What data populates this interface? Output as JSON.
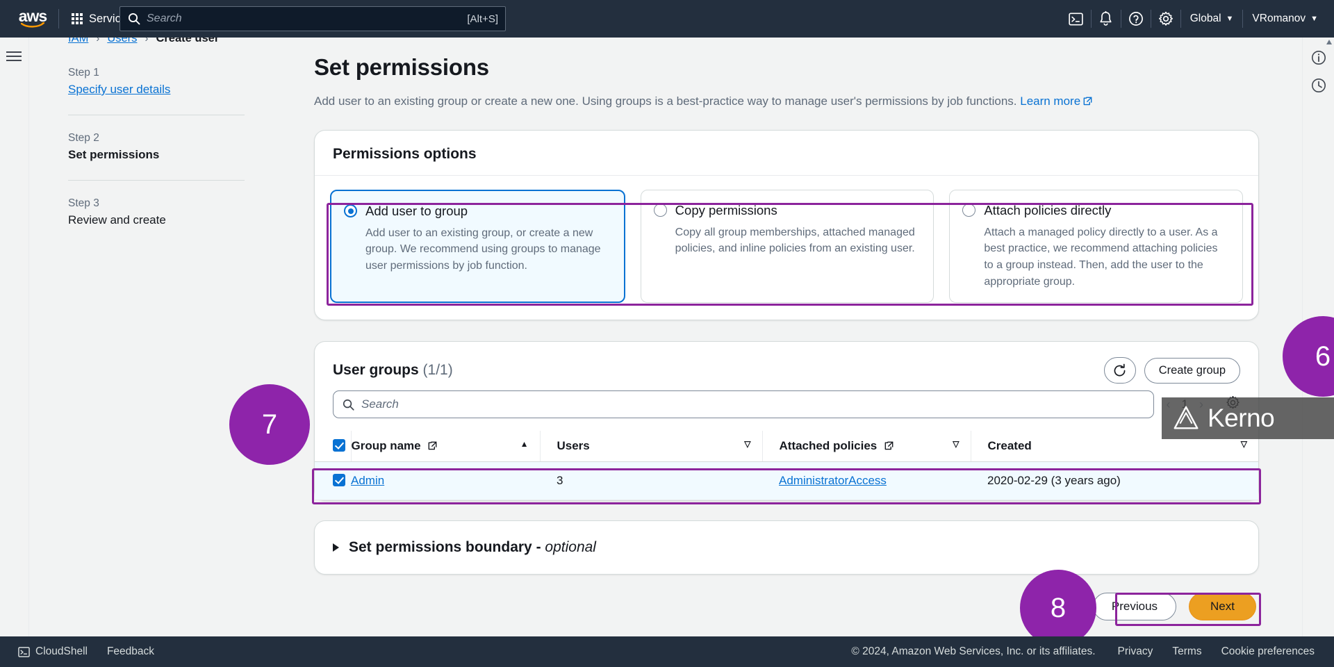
{
  "topnav": {
    "logo_alt": "aws",
    "services_label": "Services",
    "search_placeholder": "Search",
    "search_shortcut": "[Alt+S]",
    "region_label": "Global",
    "account_label": "VRomanov",
    "icons": [
      "cloudshell-icon",
      "bell-icon",
      "help-icon",
      "gear-icon"
    ]
  },
  "breadcrumb": {
    "items": [
      {
        "label": "IAM",
        "link": true
      },
      {
        "label": "Users",
        "link": true
      },
      {
        "label": "Create user",
        "link": false
      }
    ],
    "separator": "›"
  },
  "steps": [
    {
      "num": "Step 1",
      "label": "Specify user details",
      "active": false
    },
    {
      "num": "Step 2",
      "label": "Set permissions",
      "active": true
    },
    {
      "num": "Step 3",
      "label": "Review and create",
      "active": false
    }
  ],
  "main": {
    "title": "Set permissions",
    "description": "Add user to an existing group or create a new one. Using groups is a best-practice way to manage user's permissions by job functions.",
    "learn_more": "Learn more"
  },
  "permissions_options": {
    "panel_title": "Permissions options",
    "cards": [
      {
        "title": "Add user to group",
        "description": "Add user to an existing group, or create a new group. We recommend using groups to manage user permissions by job function.",
        "selected": true
      },
      {
        "title": "Copy permissions",
        "description": "Copy all group memberships, attached managed policies, and inline policies from an existing user.",
        "selected": false
      },
      {
        "title": "Attach policies directly",
        "description": "Attach a managed policy directly to a user. As a best practice, we recommend attaching policies to a group instead. Then, add the user to the appropriate group.",
        "selected": false
      }
    ]
  },
  "user_groups": {
    "title": "User groups",
    "count": "(1/1)",
    "refresh_label": "refresh-icon",
    "create_group_label": "Create group",
    "search_placeholder": "Search",
    "pagination": {
      "prev": "‹",
      "page": "1",
      "next": "›"
    },
    "settings_label": "gear-icon",
    "columns": [
      {
        "label": "Group name",
        "external": true,
        "sort": "asc"
      },
      {
        "label": "Users",
        "external": false,
        "sort": "none"
      },
      {
        "label": "Attached policies",
        "external": true,
        "sort": "none"
      },
      {
        "label": "Created",
        "external": false,
        "sort": "none"
      }
    ],
    "header_checkbox_checked": true,
    "rows": [
      {
        "checked": true,
        "group_name": "Admin",
        "users": "3",
        "attached_policies": "AdministratorAccess",
        "created": "2020-02-29 (3 years ago)"
      }
    ]
  },
  "permissions_boundary": {
    "title": "Set permissions boundary - ",
    "optional": "optional"
  },
  "form_actions": {
    "previous": "Previous",
    "next": "Next"
  },
  "bottombar": {
    "cloudshell": "CloudShell",
    "feedback": "Feedback",
    "copyright": "© 2024, Amazon Web Services, Inc. or its affiliates.",
    "privacy": "Privacy",
    "terms": "Terms",
    "cookie_preferences": "Cookie preferences"
  },
  "annotations": {
    "badges": [
      {
        "number": "6"
      },
      {
        "number": "7"
      },
      {
        "number": "8"
      }
    ],
    "highlight_color": "#8c249c",
    "badge_color": "#8e24aa",
    "watermark": "Kerno"
  }
}
